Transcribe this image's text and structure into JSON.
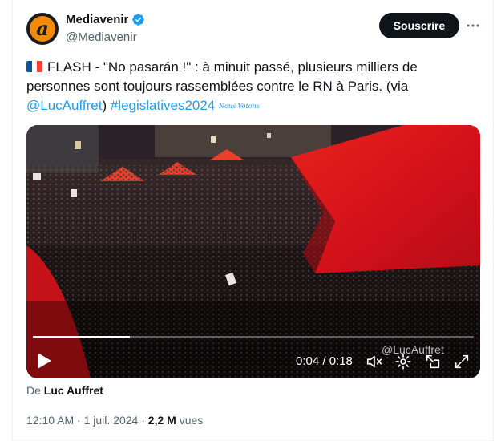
{
  "account": {
    "name": "Mediavenir",
    "handle": "@Mediavenir",
    "avatar_letter": "a",
    "verified": true
  },
  "actions": {
    "subscribe_label": "Souscrire",
    "more_icon": "more-horizontal-icon"
  },
  "tweet": {
    "flag_emoji": "france-flag-icon",
    "text_part1": "FLASH - \"No pasarán !\" : à minuit passé, plusieurs milliers de personnes sont toujours rassemblées contre le RN à Paris. (via ",
    "mention": "@LucAuffret",
    "text_part2": ") ",
    "hashtag": "#legislatives2024",
    "sticker_text": "Nous Votons"
  },
  "video": {
    "watermark": "@LucAuffret",
    "time_display": "0:04 / 0:18",
    "progress_fraction": 0.22,
    "controls": [
      "play-icon",
      "mute-icon",
      "settings-icon",
      "picture-in-picture-icon",
      "fullscreen-icon"
    ]
  },
  "source": {
    "prefix": "De",
    "author": "Luc Auffret"
  },
  "meta": {
    "time": "12:10 AM",
    "separator": "·",
    "date": "1 juil. 2024",
    "views_count": "2,2 M",
    "views_label": "vues"
  },
  "colors": {
    "accent": "#1d9bf0",
    "text": "#0f1419",
    "muted": "#536471",
    "brand_orange": "#f58a07",
    "flag_red": "#d0101a"
  }
}
